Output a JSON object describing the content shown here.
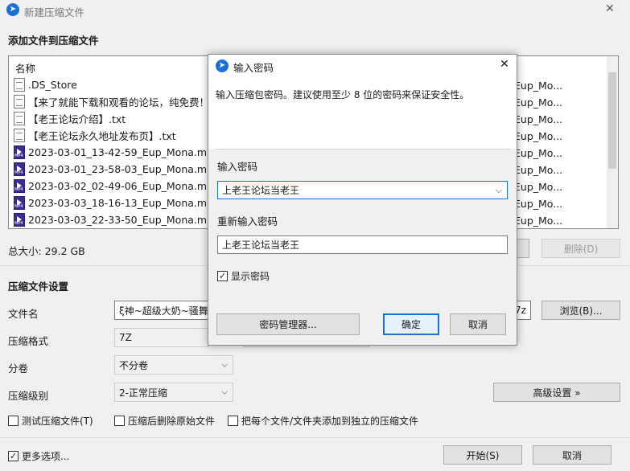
{
  "window": {
    "title": "新建压缩文件",
    "close_glyph": "✕"
  },
  "add_files_heading": "添加文件到压缩文件",
  "file_list": {
    "header_name": "名称",
    "rows": [
      {
        "icon": "file-icon",
        "name": ".DS_Store",
        "suffix": ""
      },
      {
        "icon": "text-file-icon",
        "name": "【来了就能下载和观看的论坛，纯免费！】",
        "suffix": "Eup_Mo..."
      },
      {
        "icon": "text-file-icon",
        "name": "【老王论坛介绍】.txt",
        "suffix": "Eup_Mo..."
      },
      {
        "icon": "text-file-icon",
        "name": "【老王论坛永久地址发布页】.txt",
        "suffix": "Eup_Mo..."
      },
      {
        "icon": "mp4-file-icon",
        "name": "2023-03-01_13-42-59_Eup_Mona.mp4",
        "suffix": "Eup_Mo..."
      },
      {
        "icon": "mp4-file-icon",
        "name": "2023-03-01_23-58-03_Eup_Mona.mp4",
        "suffix": "Eup_Mo..."
      },
      {
        "icon": "mp4-file-icon",
        "name": "2023-03-02_02-49-06_Eup_Mona.mp4",
        "suffix": "Eup_Mo..."
      },
      {
        "icon": "mp4-file-icon",
        "name": "2023-03-03_18-16-13_Eup_Mona.mp4",
        "suffix": "Eup_Mo..."
      },
      {
        "icon": "mp4-file-icon",
        "name": "2023-03-03_22-33-50_Eup_Mona.mp4",
        "suffix": "Eup_Mo..."
      }
    ],
    "first_suffix": "Eup_Mo..."
  },
  "total_size": "总大小: 29.2 GB",
  "delete_button": "删除(D)",
  "settings": {
    "heading": "压缩文件设置",
    "filename_label": "文件名",
    "filename_value": "ξ神~超级大奶~骚舞扌",
    "filename_suffix": "7z",
    "browse_button": "浏览(B)...",
    "format_label": "压缩格式",
    "format_value": "7Z",
    "split_label": "分卷",
    "split_value": "不分卷",
    "level_label": "压缩级别",
    "level_value": "2-正常压缩",
    "advanced_button": "高级设置 »",
    "test_checkbox": "测试压缩文件(T)",
    "delete_source_checkbox": "压缩后删除原始文件",
    "separate_checkbox": "把每个文件/文件夹添加到独立的压缩文件"
  },
  "footer": {
    "more_options": "更多选项...",
    "start_button": "开始(S)",
    "cancel_button": "取消"
  },
  "password_dialog": {
    "title": "输入密码",
    "description": "输入压缩包密码。建议使用至少 8 位的密码来保证安全性。",
    "password_label": "输入密码",
    "password_value": "上老王论坛当老王",
    "confirm_label": "重新输入密码",
    "confirm_value": "上老王论坛当老王",
    "show_password": "显示密码",
    "show_password_checked": true,
    "manager_button": "密码管理器...",
    "ok_button": "确定",
    "cancel_button": "取消"
  },
  "colors": {
    "accent": "#1c6fd6",
    "background": "#f0f0f0"
  }
}
